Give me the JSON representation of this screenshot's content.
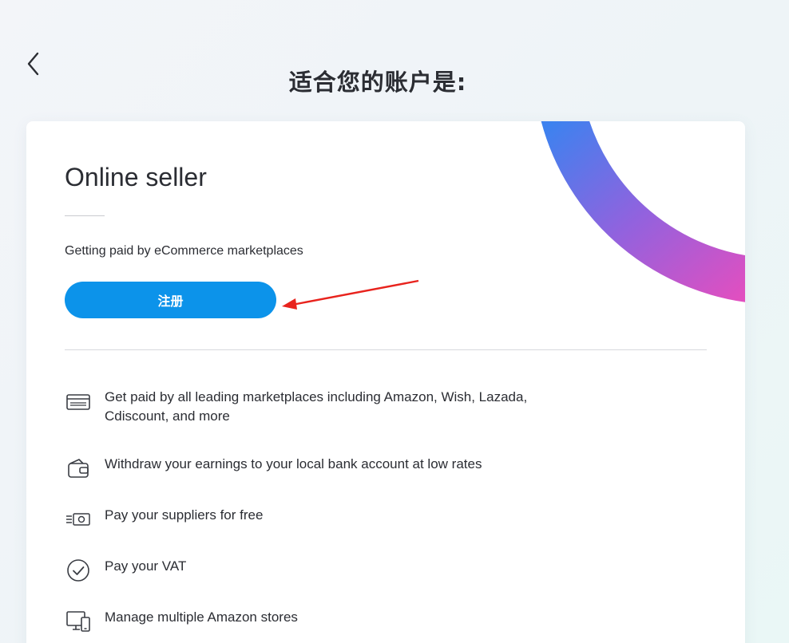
{
  "header": {
    "title": "适合您的账户是:"
  },
  "card": {
    "title": "Online seller",
    "subtitle": "Getting paid by eCommerce marketplaces",
    "register_label": "注册"
  },
  "features": [
    {
      "icon": "card-icon",
      "text": "Get paid by all leading marketplaces including Amazon, Wish, Lazada, Cdiscount, and more"
    },
    {
      "icon": "wallet-icon",
      "text": "Withdraw your earnings to your local bank account at low rates"
    },
    {
      "icon": "cash-icon",
      "text": "Pay your suppliers for free"
    },
    {
      "icon": "checkmark-circle-icon",
      "text": "Pay your VAT"
    },
    {
      "icon": "devices-icon",
      "text": "Manage multiple Amazon stores"
    }
  ],
  "colors": {
    "primary_button": "#0c93ea",
    "arc_gradient_start": "#3d82ef",
    "arc_gradient_mid": "#9262de",
    "arc_gradient_end": "#e14fc0",
    "annotation_arrow": "#e8231d"
  }
}
